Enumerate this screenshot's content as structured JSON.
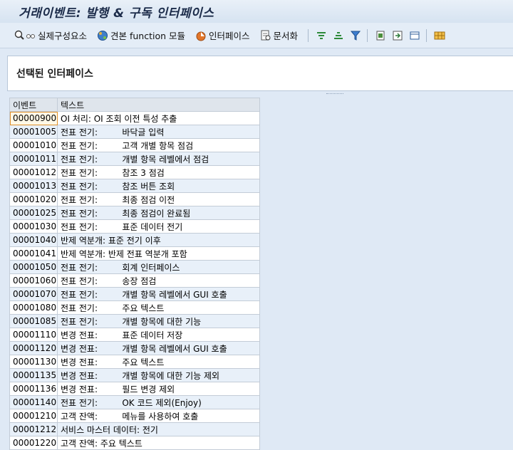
{
  "window": {
    "title": "거래이벤트: 발행 & 구독 인터페이스"
  },
  "toolbar": {
    "items": [
      {
        "label": "실제구성요소",
        "icon": "component-search-icon"
      },
      {
        "label": "견본 function 모듈",
        "icon": "sample-function-icon"
      },
      {
        "label": "인터페이스",
        "icon": "interface-icon"
      },
      {
        "label": "문서화",
        "icon": "documentation-icon"
      }
    ],
    "tools": [
      "sort-ascending-icon",
      "sort-descending-icon",
      "filter-icon",
      "export-icon",
      "print-preview-icon",
      "layout-icon",
      "grid-icon"
    ]
  },
  "header": {
    "title": "선택된 인터페이스"
  },
  "table": {
    "columns": [
      "이벤트",
      "텍스트"
    ],
    "rows": [
      [
        "00000900",
        "OI 처리: OI 조회 이전 특성 추출"
      ],
      [
        "00001005",
        "전표 전기:         바닥글 입력"
      ],
      [
        "00001010",
        "전표 전기:         고객 개별 항목 점검"
      ],
      [
        "00001011",
        "전표 전기:         개별 항목 레벨에서 점검"
      ],
      [
        "00001012",
        "전표 전기:         참조 3 점검"
      ],
      [
        "00001013",
        "전표 전기:         참조 버튼 조회"
      ],
      [
        "00001020",
        "전표 전기:         최종 점검 이전"
      ],
      [
        "00001025",
        "전표 전기:         최종 점검이 완료됨"
      ],
      [
        "00001030",
        "전표 전기:         표준 데이터 전기"
      ],
      [
        "00001040",
        "반제 역분개: 표준 전기 이후"
      ],
      [
        "00001041",
        "반제 역분개: 반제 전표 역분개 포함"
      ],
      [
        "00001050",
        "전표 전기:         회계 인터페이스"
      ],
      [
        "00001060",
        "전표 전기:         송장 점검"
      ],
      [
        "00001070",
        "전표 전기:         개별 항목 레벨에서 GUI 호출"
      ],
      [
        "00001080",
        "전표 전기:         주요 텍스트"
      ],
      [
        "00001085",
        "전표 전기:         개별 항목에 대한 기능"
      ],
      [
        "00001110",
        "변경 전표:         표준 데이터 저장"
      ],
      [
        "00001120",
        "변경 전표:         개별 항목 레벨에서 GUI 호출"
      ],
      [
        "00001130",
        "변경 전표:         주요 텍스트"
      ],
      [
        "00001135",
        "변경 전표:         개별 항목에 대한 기능 제외"
      ],
      [
        "00001136",
        "변경 전표:         필드 변경 제외"
      ],
      [
        "00001140",
        "전표 전기:         OK 코드 제외(Enjoy)"
      ],
      [
        "00001210",
        "고객 잔액:         메뉴를 사용하여 호출"
      ],
      [
        "00001212",
        "서비스 마스터 데이터: 전기"
      ],
      [
        "00001220",
        "고객 잔액: 주요 텍스트"
      ]
    ]
  }
}
